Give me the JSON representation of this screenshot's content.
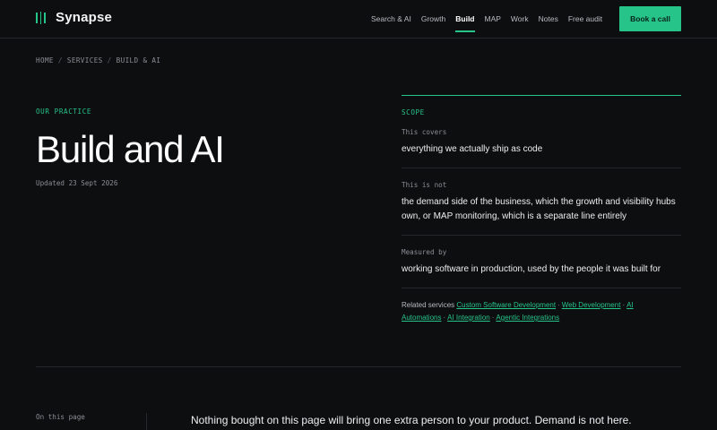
{
  "brand": {
    "name": "Synapse",
    "icon": "bars-icon",
    "accent": "#27c48a"
  },
  "nav": {
    "items": [
      {
        "label": "Search & AI",
        "active": false
      },
      {
        "label": "Growth",
        "active": false
      },
      {
        "label": "Build",
        "active": true
      },
      {
        "label": "MAP",
        "active": false
      },
      {
        "label": "Work",
        "active": false
      },
      {
        "label": "Notes",
        "active": false
      },
      {
        "label": "Free audit",
        "active": false
      }
    ],
    "cta": "Book a call"
  },
  "breadcrumb": [
    "HOME",
    "SERVICES",
    "BUILD & AI"
  ],
  "hero": {
    "kicker": "OUR PRACTICE",
    "title": "Build and AI",
    "updated": "Updated 23 Sept 2026"
  },
  "scope": {
    "heading": "SCOPE",
    "rows": [
      {
        "label": "This covers",
        "value": "everything we actually ship as code"
      },
      {
        "label": "This is not",
        "value": "the demand side of the business, which the growth and visibility hubs own, or MAP monitoring, which is a separate line entirely"
      },
      {
        "label": "Measured by",
        "value": "working software in production, used by the people it was built for"
      }
    ],
    "related_label": "Related services",
    "related": [
      "Custom Software Development",
      "Web Development",
      "AI Automations",
      "AI Integration",
      "Agentic Integrations"
    ]
  },
  "toc": {
    "label": "On this page"
  },
  "lede": "Nothing bought on this page will bring one extra person to your product. Demand is not here."
}
